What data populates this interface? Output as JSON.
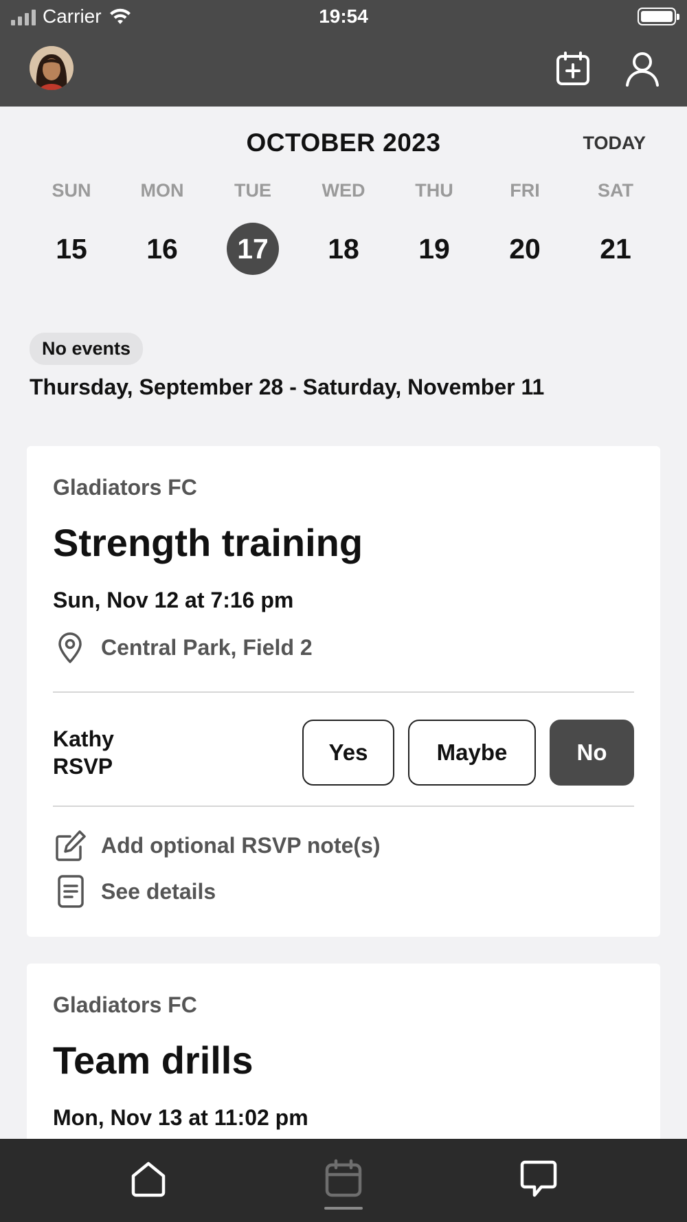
{
  "status_bar": {
    "carrier": "Carrier",
    "time": "19:54"
  },
  "header": {
    "avatar": "user-avatar",
    "icons": [
      "calendar-add-icon",
      "profile-icon"
    ]
  },
  "calendar": {
    "month_title": "OCTOBER 2023",
    "today_label": "TODAY",
    "days": [
      {
        "dow": "SUN",
        "num": "15"
      },
      {
        "dow": "MON",
        "num": "16"
      },
      {
        "dow": "TUE",
        "num": "17"
      },
      {
        "dow": "WED",
        "num": "18"
      },
      {
        "dow": "THU",
        "num": "19"
      },
      {
        "dow": "FRI",
        "num": "20"
      },
      {
        "dow": "SAT",
        "num": "21"
      }
    ],
    "selected_day": "17"
  },
  "no_events": {
    "badge": "No events",
    "range": "Thursday, September 28 - Saturday, November 11"
  },
  "events": [
    {
      "team": "Gladiators FC",
      "title": "Strength training",
      "when": "Sun, Nov 12 at 7:16 pm",
      "location": "Central Park, Field 2",
      "rsvp_name": "Kathy",
      "rsvp_label": "RSVP",
      "rsvp_options": [
        "Yes",
        "Maybe",
        "No"
      ],
      "rsvp_selected": "No",
      "add_note": "Add optional RSVP note(s)",
      "see_details": "See details"
    },
    {
      "team": "Gladiators FC",
      "title": "Team drills",
      "when": "Mon, Nov 13 at 11:02 pm"
    }
  ],
  "tabbar": {
    "tabs": [
      "home-icon",
      "calendar-icon",
      "chat-icon"
    ],
    "active_tab": "calendar-icon"
  },
  "colors": {
    "header_bg": "#4a4a4a",
    "tabbar_bg": "#2b2b2b",
    "selected": "#4a4a4a"
  }
}
